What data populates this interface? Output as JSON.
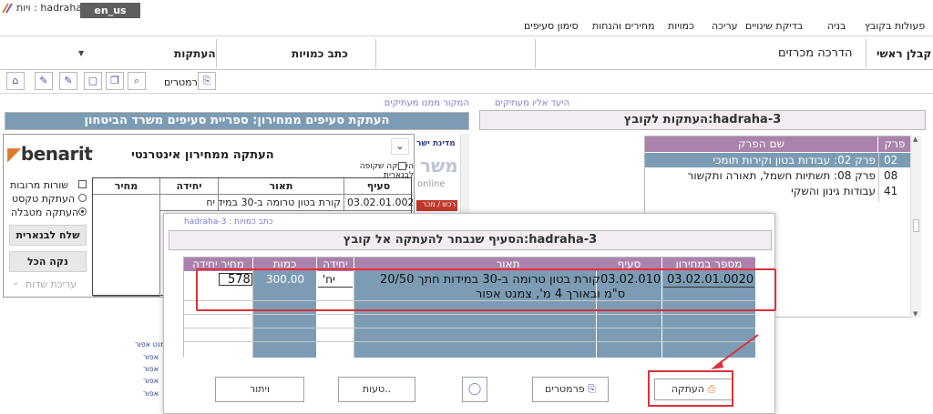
{
  "window": {
    "title": "hadraha-3 : ויות",
    "lang_tab": "en_us"
  },
  "menu": [
    "פעולות בקובץ",
    "בניה",
    "בדיקת שינויים",
    "עריכה",
    "כמויות",
    "מחירים והנחות",
    "סימון סעיפים"
  ],
  "header": {
    "contractor": "קבלן ראשי",
    "guide": "הדרכה מכרזים",
    "quantities": "כתב כמויות",
    "copies": "העתקות"
  },
  "toolbar": {
    "params_label": "פרמטרים"
  },
  "left": {
    "section_label": "המקור ממנו מעתיקים",
    "bar_title": "העתקת סעיפים ממחירון: ספריית סעיפים משרד הביטחון",
    "dialog": {
      "brand": "benarit",
      "title": "העתקה ממחירון אינטרנטי",
      "transparent_label": "העתקה שקופה לבנארית",
      "options": [
        "שורות מרובות",
        "העתקת טקסט",
        "העתקה מטבלה"
      ],
      "send_button": "שלח לבנארית",
      "clear_button": "נקה הכל",
      "edit_fields": "עריכת שדות",
      "table_headers": [
        "סעיף",
        "תאור",
        "יחידה",
        "מחיר"
      ],
      "table_row": [
        "03.02.01.0020",
        "קורת בטון טרומה ב-30 במידות",
        "יח",
        ""
      ]
    },
    "browser_fragments": [
      "מדינת ישר",
      "משר",
      "online",
      "רכש / מכר"
    ],
    "side_texts": [
      "צמנט אפור",
      "אפור",
      "אפור",
      "אפור",
      "אפור"
    ]
  },
  "right": {
    "section_label": "היעד אליו מעתיקים",
    "bar_title": "העתקות לקובץ:hadraha-3",
    "headers": [
      "פרק",
      "שם הפרק"
    ],
    "rows": [
      {
        "num": "02",
        "name": "פרק 02: עבודות בטון וקירות תומכי"
      },
      {
        "num": "08",
        "name": "פרק 08: תשתיות חשמל, תאורה ותקשור"
      },
      {
        "num": "41",
        "name": "עבודות גינון והשקי"
      }
    ]
  },
  "copy_dialog": {
    "tab_label": "כתב כמויות : hadraha-3",
    "bar_title": "הסעיף שנבחר להעתקה אל קובץ:hadraha-3",
    "headers": [
      "מספר במחירון",
      "סעיף",
      "תאור",
      "יחידה",
      "כמות",
      "מחיר יחידה"
    ],
    "row": {
      "catalog_no": "03.02.01.0020",
      "item": "03.02.010",
      "desc_line1": "קורת בטון טרומה ב-30 במידות חתך 20/50",
      "desc_line2": "ס\"מ ובאורך 4 מ', צמנט אפור",
      "unit": "יח'",
      "qty": "300.00",
      "price": "578"
    },
    "buttons": {
      "copy": "העתקה",
      "params": "פרמטרים",
      "errors": "..טעות",
      "cancel": "ויתור"
    }
  },
  "colors": {
    "header_purple": "#ab82ac",
    "selection_blue": "#7b9cb4",
    "highlight_red": "#d9333b"
  }
}
